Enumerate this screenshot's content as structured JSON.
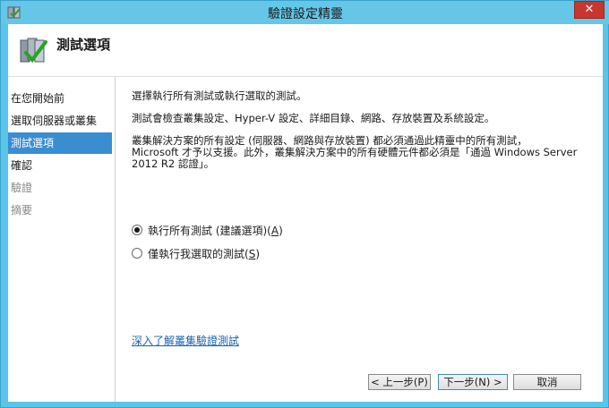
{
  "window": {
    "title": "驗證設定精靈",
    "close_glyph": "✕"
  },
  "header": {
    "title": "測試選項",
    "icon": "validation-wizard-icon"
  },
  "sidebar": {
    "items": [
      {
        "label": "在您開始前",
        "state": "normal"
      },
      {
        "label": "選取伺服器或叢集",
        "state": "normal"
      },
      {
        "label": "測試選項",
        "state": "active"
      },
      {
        "label": "確認",
        "state": "normal"
      },
      {
        "label": "驗證",
        "state": "disabled"
      },
      {
        "label": "摘要",
        "state": "disabled"
      }
    ]
  },
  "main": {
    "intro": "選擇執行所有測試或執行選取的測試。",
    "description": "測試會檢查叢集設定、Hyper-V 設定、詳細目錄、網路、存放裝置及系統設定。",
    "support_line1": "叢集解決方案的所有設定 (伺服器、網路與存放裝置) 都必須通過此精靈中的所有測試，",
    "support_line2": "Microsoft 才予以支援。此外，叢集解決方案中的所有硬體元件都必須是「通過 Windows Server",
    "support_line3": "2012 R2 認證」。",
    "radio_all": {
      "text": "執行所有測試 (建議選項)(",
      "key": "A",
      "suffix": ")",
      "checked": true
    },
    "radio_selected": {
      "text": "僅執行我選取的測試(",
      "key": "S",
      "suffix": ")",
      "checked": false
    },
    "learn_more": "深入了解叢集驗證測試"
  },
  "footer": {
    "prev": "< 上一步(P)",
    "next": "下一步(N) >",
    "cancel": "取消"
  },
  "colors": {
    "accent": "#3a8dd0",
    "chrome": "#5bc4e8",
    "close": "#c7372f"
  }
}
